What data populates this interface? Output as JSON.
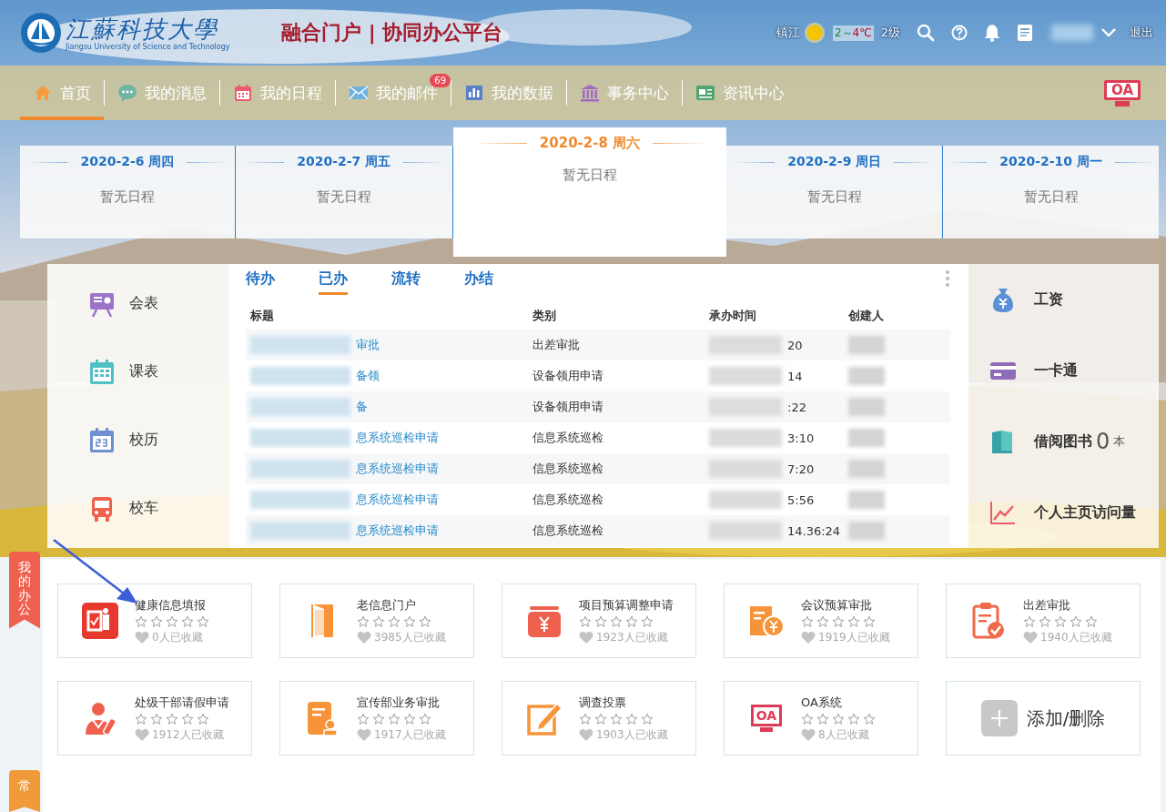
{
  "header": {
    "logo_text": "江蘇科技大學",
    "logo_subtitle": "Jiangsu University of Science and Technology",
    "portal_title": "融合门户 | 协同办公平台",
    "weather": {
      "city": "镇江",
      "temp_low": "2～",
      "temp_high": "4℃",
      "wind": "2级"
    },
    "logout": "退出"
  },
  "nav": [
    {
      "label": "首页",
      "selected": true
    },
    {
      "label": "我的消息",
      "selected": false
    },
    {
      "label": "我的日程",
      "selected": false
    },
    {
      "label": "我的邮件",
      "selected": false,
      "badge": "69"
    },
    {
      "label": "我的数据",
      "selected": false
    },
    {
      "label": "事务中心",
      "selected": false
    },
    {
      "label": "资讯中心",
      "selected": false
    }
  ],
  "nav_logo": "OA",
  "schedule": [
    {
      "date": "2020-2-6 周四",
      "text": "暂无日程",
      "selected": false
    },
    {
      "date": "2020-2-7 周五",
      "text": "暂无日程",
      "selected": false
    },
    {
      "date": "2020-2-8 周六",
      "text": "暂无日程",
      "selected": true
    },
    {
      "date": "2020-2-9 周日",
      "text": "暂无日程",
      "selected": false
    },
    {
      "date": "2020-2-10 周一",
      "text": "暂无日程",
      "selected": false
    }
  ],
  "quick_links": [
    {
      "label": "会表"
    },
    {
      "label": "课表"
    },
    {
      "label": "校历"
    },
    {
      "label": "校车"
    }
  ],
  "tasks": {
    "tabs": [
      {
        "label": "待办",
        "selected": false
      },
      {
        "label": "已办",
        "selected": true
      },
      {
        "label": "流转",
        "selected": false
      },
      {
        "label": "办结",
        "selected": false
      }
    ],
    "columns": [
      "标题",
      "类别",
      "承办时间",
      "创建人"
    ],
    "rows": [
      {
        "title": "审批",
        "category": "出差审批",
        "time": "20"
      },
      {
        "title": "备领",
        "category": "设备领用申请",
        "time": "14"
      },
      {
        "title": "备",
        "category": "设备领用申请",
        "time": ":22"
      },
      {
        "title": "息系统巡检申请",
        "category": "信息系统巡检",
        "time": "3:10"
      },
      {
        "title": "息系统巡检申请",
        "category": "信息系统巡检",
        "time": "7:20"
      },
      {
        "title": "息系统巡检申请",
        "category": "信息系统巡检",
        "time": "5:56"
      },
      {
        "title": "息系统巡检申请",
        "category": "信息系统巡检",
        "time": "14.36:24"
      }
    ]
  },
  "side_links": [
    {
      "label": "工资"
    },
    {
      "label": "一卡通"
    },
    {
      "label": "借阅图书",
      "count": "0",
      "unit": "本"
    },
    {
      "label": "个人主页访问量"
    }
  ],
  "sections": [
    {
      "label": "我的办公",
      "color": "#f0604e"
    },
    {
      "label": "常",
      "color": "#f09a3a"
    }
  ],
  "apps": [
    {
      "name": "健康信息填报",
      "stars": 0,
      "favorites": "0人已收藏"
    },
    {
      "name": "老信息门户",
      "stars": 0,
      "favorites": "3985人已收藏"
    },
    {
      "name": "项目预算调整申请",
      "stars": 0,
      "favorites": "1923人已收藏"
    },
    {
      "name": "会议预算审批",
      "stars": 0,
      "favorites": "1919人已收藏"
    },
    {
      "name": "出差审批",
      "stars": 0,
      "favorites": "1940人已收藏"
    },
    {
      "name": "处级干部请假申请",
      "stars": 0,
      "favorites": "1912人已收藏"
    },
    {
      "name": "宣传部业务审批",
      "stars": 0,
      "favorites": "1917人已收藏"
    },
    {
      "name": "调查投票",
      "stars": 0,
      "favorites": "1903人已收藏"
    },
    {
      "name": "OA系统",
      "stars": 0,
      "favorites": "8人已收藏",
      "icon_text": "OA"
    }
  ],
  "add_button": "添加/删除"
}
